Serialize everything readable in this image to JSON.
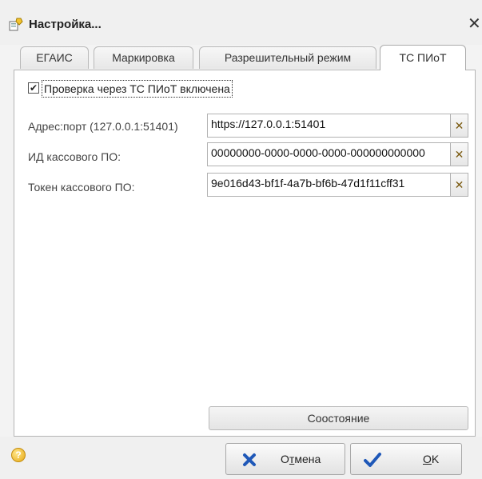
{
  "window": {
    "title": "Настройка...",
    "close_glyph": "✕",
    "icon": "settings-wrench-icon"
  },
  "tabs": [
    {
      "label": "ЕГАИС",
      "active": false
    },
    {
      "label": "Маркировка",
      "active": false
    },
    {
      "label": "Разрешительный режим",
      "active": false
    },
    {
      "label": "ТС ПИоТ",
      "active": true
    }
  ],
  "panel": {
    "checkbox": {
      "label": "Проверка через ТС ПИоТ включена",
      "checked": true,
      "check_glyph": "✔"
    },
    "fields": [
      {
        "label": "Адрес:порт (127.0.0.1:51401)",
        "value": "https://127.0.0.1:51401",
        "clear_glyph": "✕"
      },
      {
        "label": "ИД кассового ПО:",
        "value": "00000000-0000-0000-0000-000000000000",
        "clear_glyph": "✕"
      },
      {
        "label": "Токен кассового ПО:",
        "value": "9e016d43-bf1f-4a7b-bf6b-47d1f11cff31",
        "clear_glyph": "✕"
      }
    ],
    "state_button": "Соостояние"
  },
  "footer": {
    "help_glyph": "?",
    "cancel": {
      "pre": "О",
      "underlined": "т",
      "post": "мена",
      "icon": "cancel-x-icon"
    },
    "ok": {
      "pre": "",
      "underlined": "O",
      "post": "K",
      "icon": "checkmark-icon"
    }
  },
  "colors": {
    "cancel_icon": "#1f58b8",
    "ok_icon": "#1f58b8",
    "clear_icon": "#7a5a10"
  }
}
